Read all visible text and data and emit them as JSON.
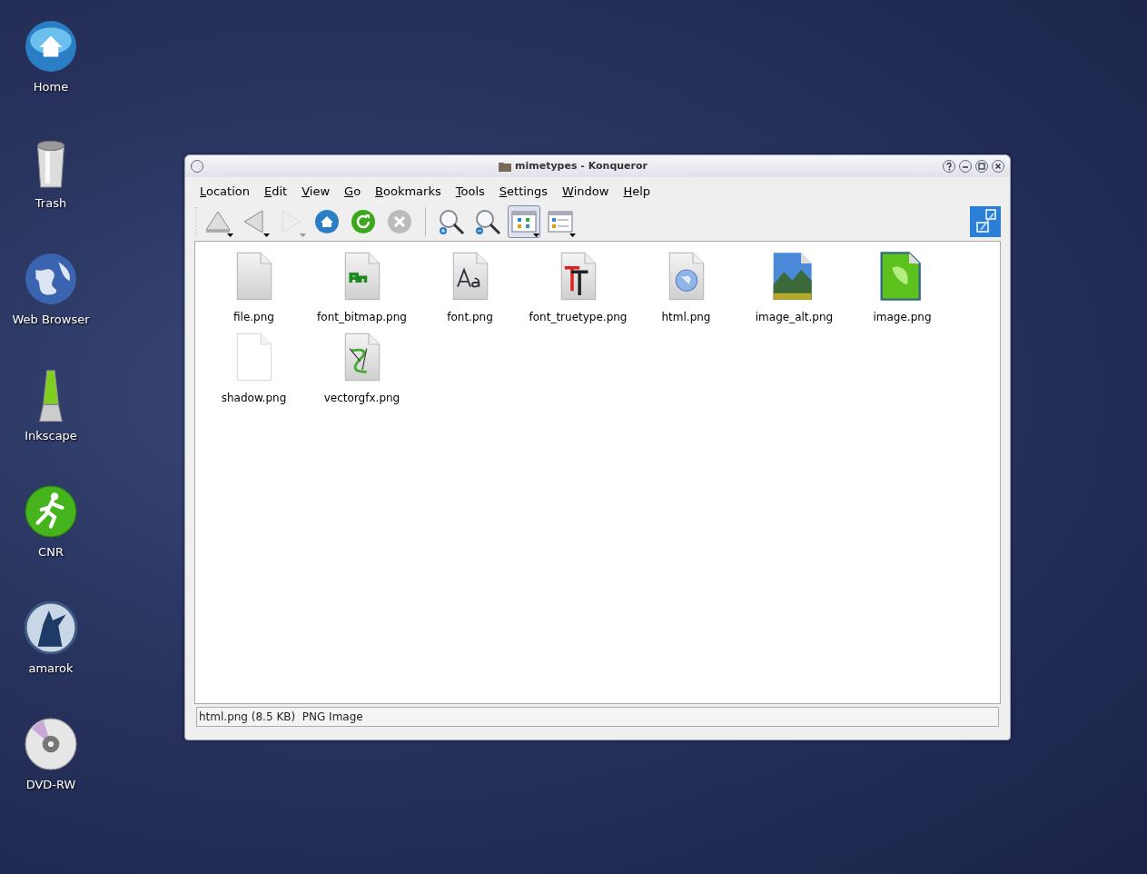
{
  "desktop_icons": [
    {
      "label": "Home",
      "kind": "home"
    },
    {
      "label": "Trash",
      "kind": "trash"
    },
    {
      "label": "Web Browser",
      "kind": "globe"
    },
    {
      "label": "Inkscape",
      "kind": "lamp"
    },
    {
      "label": "CNR",
      "kind": "runner"
    },
    {
      "label": "amarok",
      "kind": "wolf"
    },
    {
      "label": "DVD-RW",
      "kind": "disc"
    }
  ],
  "window": {
    "title": "mimetypes - Konqueror",
    "menu": [
      "Location",
      "Edit",
      "View",
      "Go",
      "Bookmarks",
      "Tools",
      "Settings",
      "Window",
      "Help"
    ],
    "toolbar": [
      {
        "kind": "up",
        "has_menu": true,
        "disabled": false
      },
      {
        "kind": "back",
        "has_menu": true,
        "disabled": false
      },
      {
        "kind": "forward",
        "has_menu": true,
        "disabled": true
      },
      {
        "kind": "home",
        "has_menu": false,
        "disabled": false
      },
      {
        "kind": "reload",
        "has_menu": false,
        "disabled": false
      },
      {
        "kind": "stop",
        "has_menu": false,
        "disabled": false
      },
      {
        "kind": "separator"
      },
      {
        "kind": "zoom-in",
        "has_menu": false,
        "disabled": false
      },
      {
        "kind": "zoom-out",
        "has_menu": false,
        "disabled": false
      },
      {
        "kind": "icon-view",
        "has_menu": true,
        "disabled": false,
        "selected": true
      },
      {
        "kind": "list-view",
        "has_menu": true,
        "disabled": false,
        "selected": false
      }
    ],
    "files": [
      {
        "name": "file.png",
        "kind": "blank"
      },
      {
        "name": "font_bitmap.png",
        "kind": "bitmap-font"
      },
      {
        "name": "font.png",
        "kind": "font"
      },
      {
        "name": "font_truetype.png",
        "kind": "truetype"
      },
      {
        "name": "html.png",
        "kind": "html"
      },
      {
        "name": "image_alt.png",
        "kind": "landscape"
      },
      {
        "name": "image.png",
        "kind": "leaf"
      },
      {
        "name": "shadow.png",
        "kind": "shadow"
      },
      {
        "name": "vectorgfx.png",
        "kind": "vector"
      }
    ],
    "status_bar": "html.png (8.5 KB)  PNG Image"
  }
}
